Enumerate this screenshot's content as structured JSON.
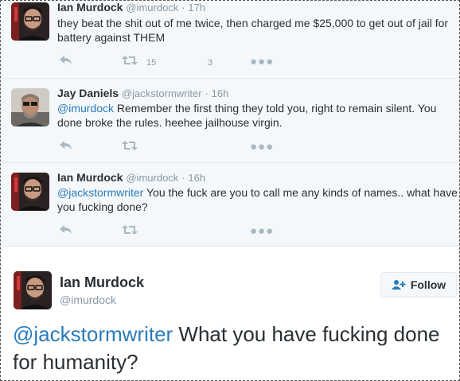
{
  "tweets": [
    {
      "name": "Ian Murdock",
      "handle": "@imurdock",
      "time": "17h",
      "text": "they beat the shit out of me twice, then charged me $25,000 to get out of jail for battery against THEM",
      "retweets": "15",
      "favorites": "3"
    },
    {
      "name": "Jay Daniels",
      "handle": "@jackstormwriter",
      "time": "16h",
      "mention": "@imurdock",
      "text": " Remember the first thing they told you, right to remain silent. You done broke the rules. heehee jailhouse virgin."
    },
    {
      "name": "Ian Murdock",
      "handle": "@imurdock",
      "time": "16h",
      "mention": "@jackstormwriter",
      "text": " You the fuck are you to call me any kinds of names.. what have you fucking done?"
    }
  ],
  "main": {
    "name": "Ian Murdock",
    "handle": "@imurdock",
    "follow_label": "Follow",
    "mention": "@jackstormwriter",
    "text": " What you have fucking done for humanity?"
  },
  "separator": "·",
  "colors": {
    "link": "#2b7bb9",
    "muted": "#8899a6",
    "background": "#f5f8fa"
  },
  "icons": [
    "reply-icon",
    "retweet-icon",
    "more-icon",
    "follow-user-icon"
  ]
}
